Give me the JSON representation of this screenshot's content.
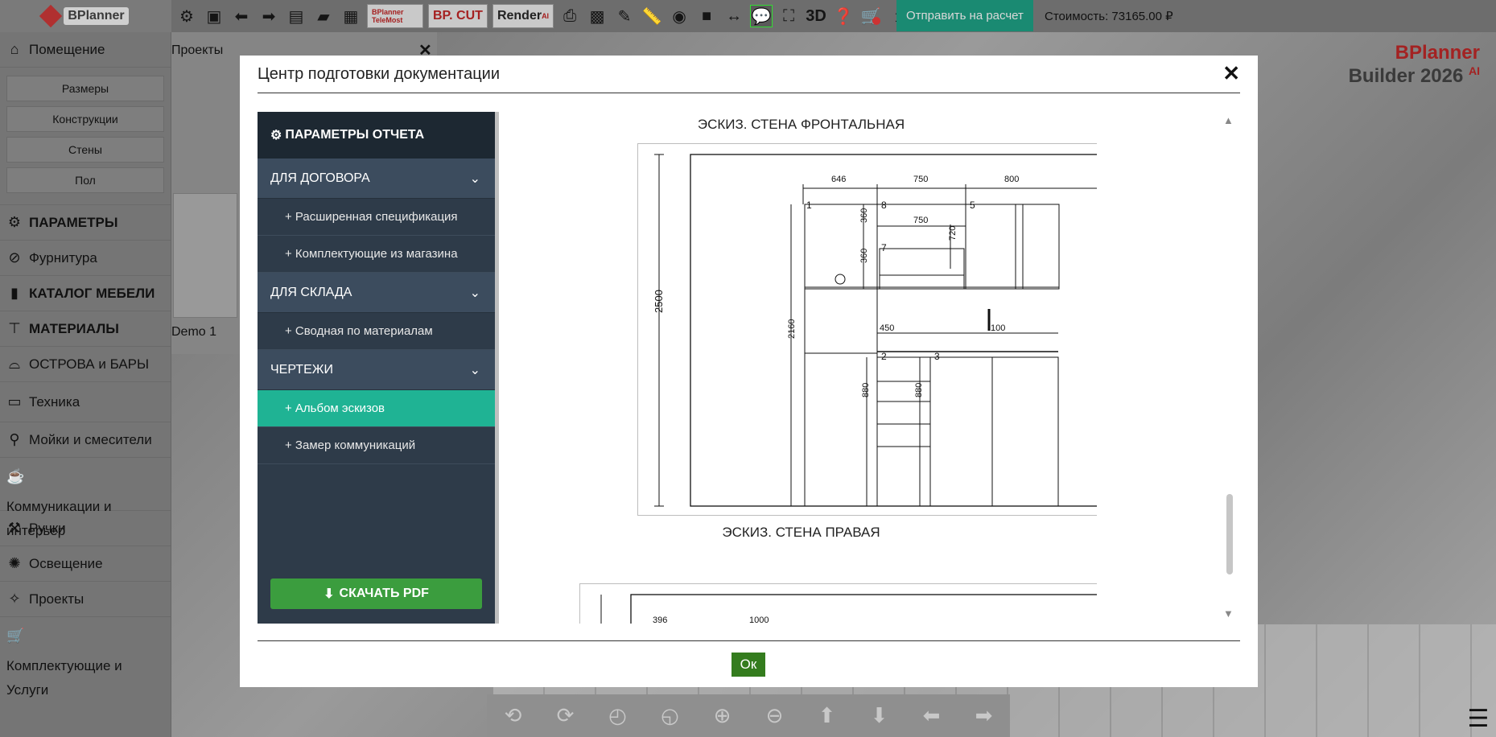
{
  "app": {
    "logo_text": "BPlanner",
    "send_button": "Отправить на расчет",
    "cost": "Стоимость: 73165.00 ₽",
    "brand_line1": "BPlanner",
    "brand_line2": "Builder 2026",
    "brand_sup": "AI"
  },
  "toolbar": {
    "telemost_label": "BPlanner TeleMost",
    "bpcut_label": "BP. CUT",
    "render_label": "Render",
    "render_sup": "AI",
    "view3d_label": "3D"
  },
  "sidebar": {
    "room": "Помещение",
    "room_sub": [
      "Размеры",
      "Конструкции",
      "Стены",
      "Пол"
    ],
    "items": [
      {
        "label": "ПАРАМЕТРЫ",
        "icon": "gear-icon"
      },
      {
        "label": "Фурнитура",
        "icon": "paperclip-icon"
      },
      {
        "label": "КАТАЛОГ МЕБЕЛИ",
        "icon": "cabinet-icon"
      },
      {
        "label": "МАТЕРИАЛЫ",
        "icon": "paint-roller-icon"
      },
      {
        "label": "ОСТРОВА и БАРЫ",
        "icon": "island-icon"
      },
      {
        "label": "Техника",
        "icon": "monitor-icon"
      },
      {
        "label": "Мойки и смесители",
        "icon": "faucet-icon"
      },
      {
        "label": "Коммуникации и интерьер",
        "icon": "mug-icon"
      },
      {
        "label": "Ручки",
        "icon": "hammer-icon"
      },
      {
        "label": "Освещение",
        "icon": "bulb-icon"
      },
      {
        "label": "Проекты",
        "icon": "wand-icon"
      },
      {
        "label": "Комплектующие и Услуги",
        "icon": "cart-icon"
      }
    ]
  },
  "projects": {
    "title": "Проекты",
    "demo": "Demo 1"
  },
  "modal": {
    "title": "Центр подготовки документации",
    "ok": "Ок",
    "panel_title": "ПАРАМЕТРЫ ОТЧЕТА",
    "sections": [
      {
        "label": "ДЛЯ ДОГОВОРА",
        "items": [
          "+ Расширенная спецификация",
          "+ Комплектующие из магазина"
        ]
      },
      {
        "label": "ДЛЯ СКЛАДА",
        "items": [
          "+ Сводная по материалам"
        ]
      },
      {
        "label": "ЧЕРТЕЖИ",
        "items": [
          "+ Альбом эскизов",
          "+ Замер коммуникаций"
        ]
      }
    ],
    "active_item": "+ Альбом эскизов",
    "pdf_button": "СКАЧАТЬ PDF",
    "sketch1_title": "ЭСКИЗ. СТЕНА ФРОНТАЛЬНАЯ",
    "sketch2_title": "ЭСКИЗ. СТЕНА ПРАВАЯ",
    "dims": {
      "h_total": "2500",
      "h_upper": "2160",
      "w1": "646",
      "w2": "750",
      "w3": "800",
      "w_inner": "750",
      "h360a": "360",
      "h360b": "360",
      "h720": "720",
      "w450": "450",
      "w100": "100",
      "h880a": "880",
      "h880b": "880",
      "n1": "1",
      "n2": "2",
      "n3": "3",
      "n5": "5",
      "n7": "7",
      "n8": "8",
      "s2_a": "396",
      "s2_b": "1000"
    }
  },
  "colors": {
    "accent_green": "#1fb394",
    "send_green": "#1a8a72",
    "pdf_green": "#3b9d3e",
    "ok_green": "#347c1e",
    "panel_dark": "#2e3b49",
    "brand_red": "#a32222"
  }
}
